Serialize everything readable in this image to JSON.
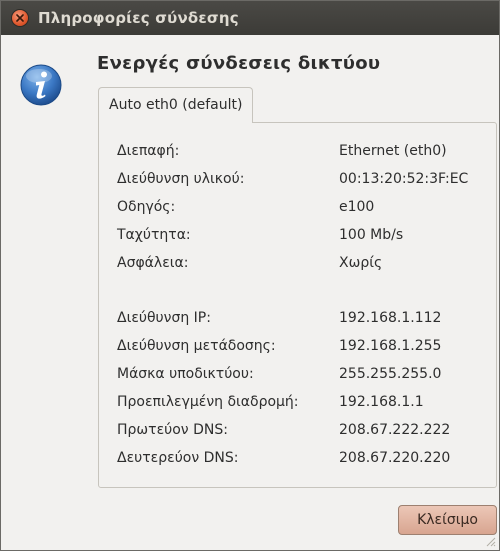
{
  "window": {
    "title": "Πληροφορίες σύνδεσης"
  },
  "dialog": {
    "heading": "Ενεργές σύνδεσεις δικτύου",
    "tab_label": "Auto eth0 (default)",
    "close_label": "Κλείσιμο"
  },
  "details": {
    "hardware": [
      {
        "label": "Διεπαφή:",
        "value": "Ethernet (eth0)"
      },
      {
        "label": "Διεύθυνση υλικού:",
        "value": "00:13:20:52:3F:EC"
      },
      {
        "label": "Οδηγός:",
        "value": "e100"
      },
      {
        "label": "Ταχύτητα:",
        "value": "100 Mb/s"
      },
      {
        "label": "Ασφάλεια:",
        "value": "Χωρίς"
      }
    ],
    "network": [
      {
        "label": "Διεύθυνση IP:",
        "value": "192.168.1.112"
      },
      {
        "label": "Διεύθυνση μετάδοσης:",
        "value": "192.168.1.255"
      },
      {
        "label": "Μάσκα υποδικτύου:",
        "value": "255.255.255.0"
      },
      {
        "label": "Προεπιλεγμένη διαδρομή:",
        "value": "192.168.1.1"
      },
      {
        "label": "Πρωτεύον DNS:",
        "value": "208.67.222.222"
      },
      {
        "label": "Δευτερεύον DNS:",
        "value": "208.67.220.220"
      }
    ]
  },
  "colors": {
    "titlebar": "#3c3b37",
    "close_button": "#e0582d",
    "info_icon": "#2f6db5",
    "dialog_bg": "#f2f1ef"
  },
  "icons": {
    "window_close": "close-icon",
    "info": "info-icon"
  }
}
